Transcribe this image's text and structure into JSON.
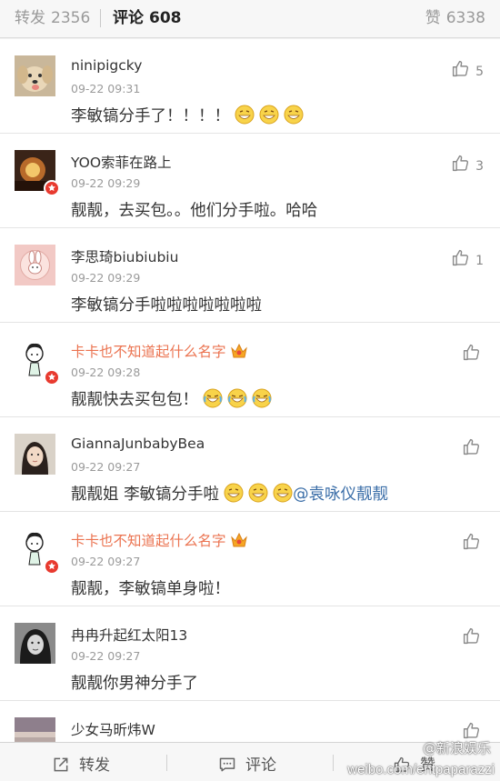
{
  "tabs": {
    "repost": {
      "label": "转发",
      "count": "2356"
    },
    "comment": {
      "label": "评论",
      "count": "608"
    },
    "like": {
      "label": "赞",
      "count": "6338"
    }
  },
  "comments": [
    {
      "name": "ninipigcky",
      "time": "09-22 09:31",
      "text": "李敏镐分手了！！！！",
      "likes": "5",
      "avatar": "dog-avatar"
    },
    {
      "name": "YOO索菲在路上",
      "time": "09-22 09:29",
      "text": "靓靓，去买包。。他们分手啦。哈哈",
      "likes": "3",
      "avatar": "sunset-avatar",
      "verified": true
    },
    {
      "name": "李思琦biubiubiu",
      "time": "09-22 09:29",
      "text": "李敏镐分手啦啦啦啦啦啦啦",
      "likes": "1",
      "avatar": "bunny-avatar"
    },
    {
      "name": "卡卡也不知道起什么名字",
      "time": "09-22 09:28",
      "text": "靓靓快去买包包！",
      "likes": "",
      "avatar": "cartoon-girl-avatar",
      "verified": true
    },
    {
      "name": "GiannaJunbabyBea",
      "time": "09-22 09:27",
      "text": "靓靓姐 李敏镐分手啦",
      "mention": "@袁咏仪靓靓",
      "likes": "",
      "avatar": "photo-avatar"
    },
    {
      "name": "卡卡也不知道起什么名字",
      "time": "09-22 09:27",
      "text": "靓靓，李敏镐单身啦！",
      "likes": "",
      "avatar": "cartoon-girl-avatar",
      "verified": true
    },
    {
      "name": "冉冉升起红太阳13",
      "time": "09-22 09:27",
      "text": "靓靓你男神分手了",
      "likes": "",
      "avatar": "bw-photo-avatar"
    },
    {
      "name": "少女马昕炜W",
      "avatar": "landscape-avatar"
    }
  ],
  "bottombar": {
    "repost_label": "转发",
    "comment_label": "评论",
    "like_label": "赞"
  },
  "watermark": {
    "logo": "@新浪娱乐",
    "url": "weibo.com/entpaparazzi"
  },
  "colors": {
    "orange_name": "#eb7350",
    "mention": "#3b6ea8",
    "badge": "#e83a2f"
  }
}
